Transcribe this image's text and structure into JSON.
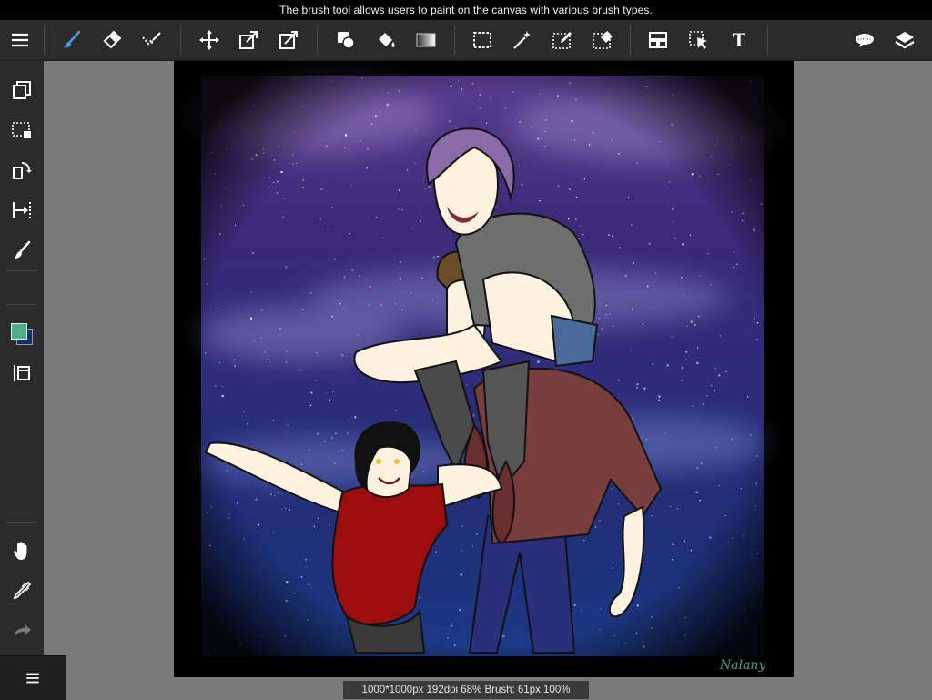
{
  "tooltip": {
    "text": "The brush tool allows users to paint on the canvas with various brush types."
  },
  "toolbar": {
    "items": [
      {
        "icon": "menu-icon"
      },
      {
        "icon": "brush-icon"
      },
      {
        "icon": "eraser-icon"
      },
      {
        "icon": "smudge-icon"
      },
      {
        "icon": "move-icon"
      },
      {
        "icon": "transform-icon"
      },
      {
        "icon": "warp-icon"
      },
      {
        "icon": "fill-shape-icon"
      },
      {
        "icon": "bucket-icon"
      },
      {
        "icon": "gradient-icon"
      },
      {
        "icon": "select-rect-icon"
      },
      {
        "icon": "magic-wand-icon"
      },
      {
        "icon": "select-pen-icon"
      },
      {
        "icon": "select-eraser-icon"
      },
      {
        "icon": "panel-layout-icon"
      },
      {
        "icon": "select-layer-icon"
      },
      {
        "icon": "text-icon",
        "label": "T"
      },
      {
        "icon": "speech-bubble-icon"
      },
      {
        "icon": "layers-icon"
      }
    ]
  },
  "sidebar": {
    "items": [
      {
        "icon": "copy-layer-icon"
      },
      {
        "icon": "selection-icon"
      },
      {
        "icon": "rotate-icon"
      },
      {
        "icon": "ruler-icon"
      },
      {
        "icon": "brush-small-icon"
      },
      {
        "icon": "color-swatch-icon"
      },
      {
        "icon": "layer-frame-icon"
      },
      {
        "icon": "hand-icon"
      },
      {
        "icon": "eyedropper-icon"
      },
      {
        "icon": "redo-icon"
      }
    ],
    "colors": {
      "foreground": "#4fae86",
      "background": "#1a2d6b"
    }
  },
  "status": {
    "text": "1000*1000px 192dpi 68% Brush: 61px 100%"
  },
  "canvas": {
    "signature": "Nalany"
  },
  "theme": {
    "accent": "#4a9ee8",
    "toolbar_bg": "#2b2b2b",
    "workspace_bg": "#7a7a7a"
  }
}
